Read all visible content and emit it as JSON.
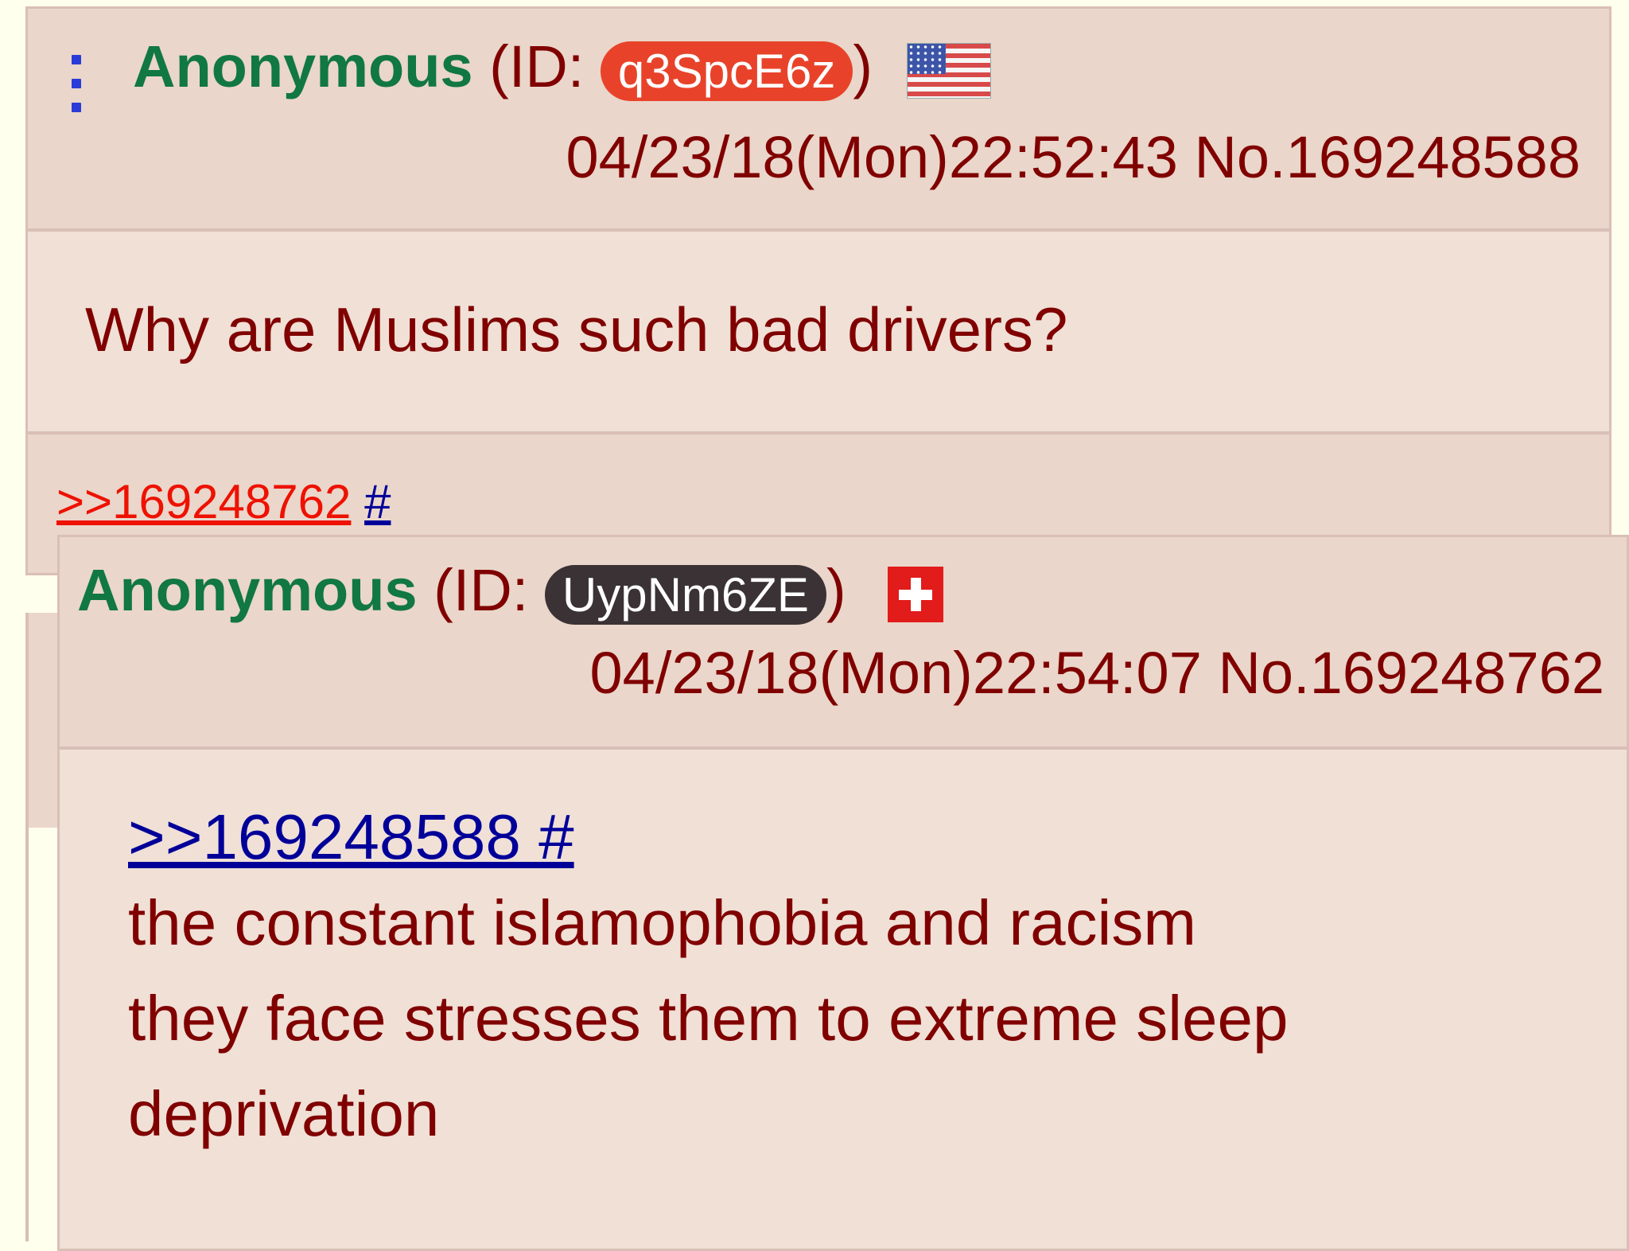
{
  "op": {
    "name": "Anonymous",
    "id_prefix": "(ID:",
    "id": "q3SpcE6z",
    "id_suffix": ")",
    "id_color": "#e8432a",
    "flag_icon": "us-flag-icon",
    "datetime": "04/23/18(Mon)22:52:43",
    "post_no": "No.169248588",
    "comment": "Why are Muslims such bad drivers?",
    "reply_link": ">>169248762",
    "hash": "#"
  },
  "reply": {
    "name": "Anonymous",
    "id_prefix": "(ID:",
    "id": "UypNm6ZE",
    "id_suffix": ")",
    "id_color": "#3a3234",
    "flag_icon": "switzerland-flag-icon",
    "datetime": "04/23/18(Mon)22:54:07",
    "post_no": "No.169248762",
    "quote_link": ">>169248588 #",
    "lines": [
      "the constant islamophobia and racism",
      "they face stresses them to extreme sleep",
      "deprivation"
    ]
  },
  "colors": {
    "page_bg": "#ffffee",
    "post_bg": "#f0e0d6",
    "header_bg": "#ead6ca",
    "border": "#d9bfb7",
    "name": "#117743",
    "text": "#800000",
    "link_red": "#ee1100",
    "link_blue": "#000099"
  }
}
